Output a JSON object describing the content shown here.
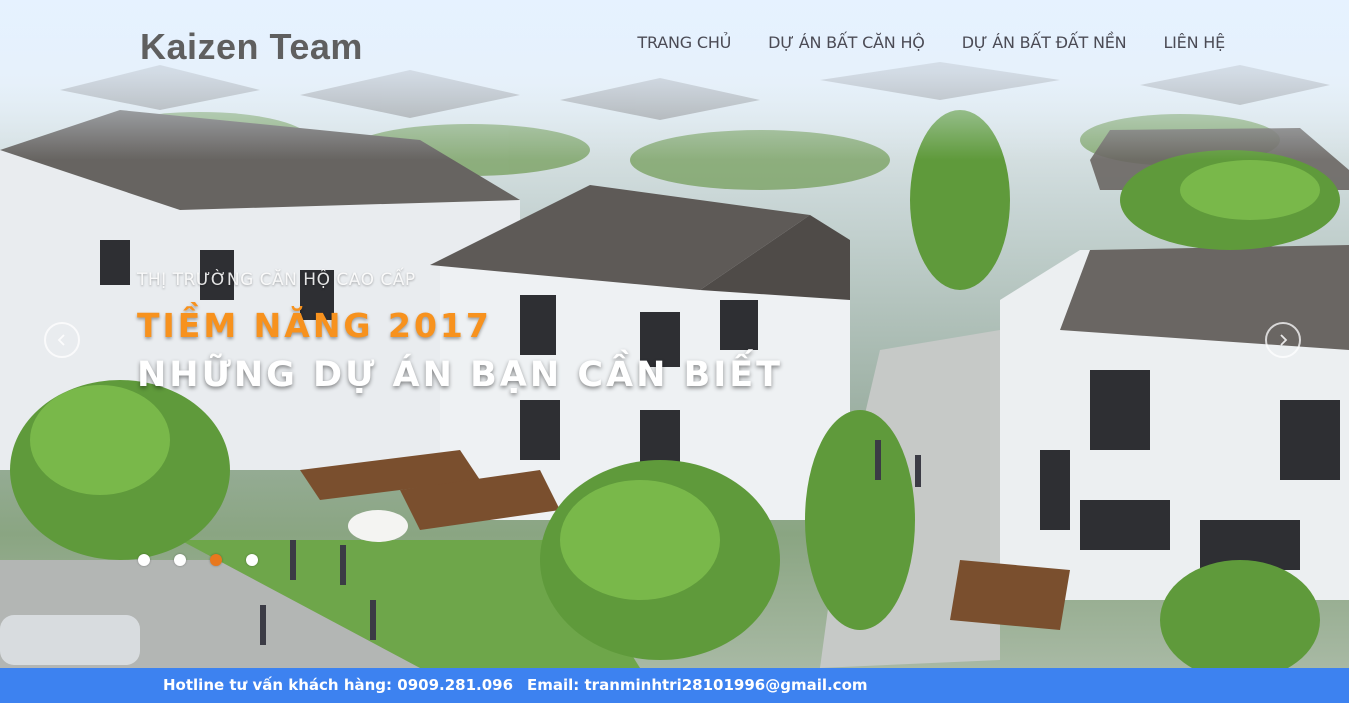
{
  "header": {
    "brand": "Kaizen Team",
    "nav": [
      {
        "label": "TRANG CHỦ"
      },
      {
        "label": "DỰ ÁN BẤT CĂN HỘ"
      },
      {
        "label": "DỰ ÁN BẤT ĐẤT NỀN"
      },
      {
        "label": "LIÊN HỆ"
      }
    ]
  },
  "hero": {
    "image": "aerial-rendering-of-townhouse-villa-street",
    "eyebrow": "THỊ TRƯỜNG CĂN HỘ CAO CẤP",
    "headline_1": "TIỀM NĂNG 2017",
    "headline_2": "NHỮNG DỰ ÁN BẠN CẦN BIẾT",
    "prev_icon": "chevron-left-icon",
    "next_icon": "chevron-right-icon",
    "slides_count": 4,
    "active_slide": 3
  },
  "footer": {
    "hotline": "Hotline tư vấn khách hàng: 0909.281.096",
    "email": "Email: tranminhtri28101996@gmail.com"
  },
  "colors": {
    "accent_orange": "#f7921e",
    "footer_blue": "#3d82f0",
    "brand_gray": "#5f5f5f"
  }
}
